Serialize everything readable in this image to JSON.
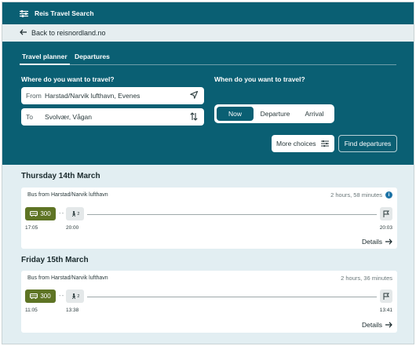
{
  "app": {
    "title": "Reis Travel Search"
  },
  "nav": {
    "back_label": "Back to reisnordland.no"
  },
  "tabs": [
    {
      "label": "Travel planner",
      "active": true
    },
    {
      "label": "Departures",
      "active": false
    }
  ],
  "planner": {
    "where_label": "Where do you want to travel?",
    "from_label": "From",
    "from_value": "Harstad/Narvik lufthavn, Evenes",
    "to_label": "To",
    "to_value": "Svolvær, Vågan",
    "when_label": "When do you want to travel?",
    "when_options": [
      "Now",
      "Departure",
      "Arrival"
    ],
    "when_selected": "Now",
    "more_choices_label": "More choices",
    "find_label": "Find departures"
  },
  "results": [
    {
      "day": "Thursday 14th March",
      "route": "Bus from Harstad/Narvik lufthavn",
      "duration": "2 hours, 58 minutes",
      "show_info": true,
      "line": "300",
      "walk": "2",
      "dep_time": "17:05",
      "walk_time": "20:00",
      "arr_time": "20:03",
      "details_label": "Details"
    },
    {
      "day": "Friday 15th March",
      "route": "Bus from Harstad/Narvik lufthavn",
      "duration": "2 hours, 36 minutes",
      "show_info": false,
      "line": "300",
      "walk": "2",
      "dep_time": "11:05",
      "walk_time": "13:38",
      "arr_time": "13:41",
      "details_label": "Details"
    }
  ],
  "colors": {
    "brand": "#0a5f73",
    "bus": "#5e7424",
    "background": "#e2eef2"
  }
}
